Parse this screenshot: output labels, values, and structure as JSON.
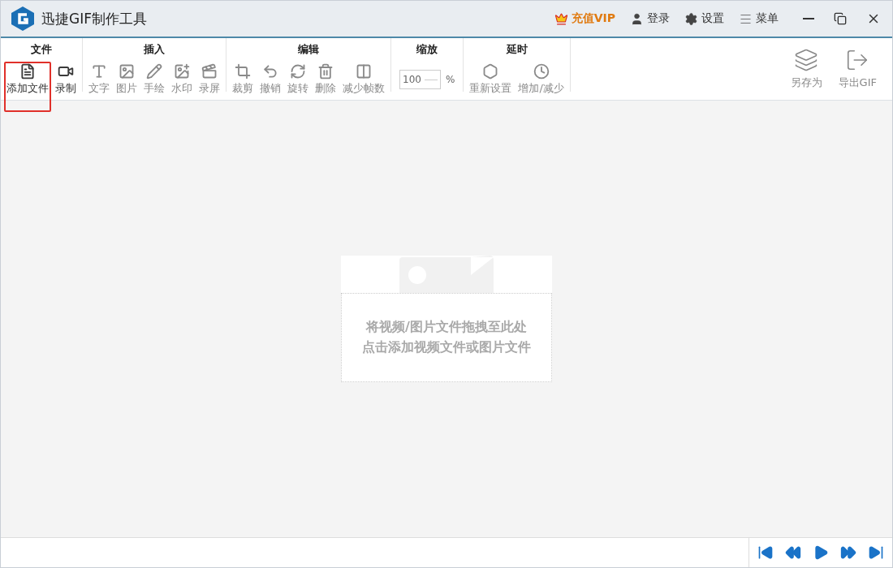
{
  "window": {
    "title": "迅捷GIF制作工具"
  },
  "header_actions": [
    {
      "label": "充值VIP",
      "kind": "vip"
    },
    {
      "label": "登录",
      "kind": "plain"
    },
    {
      "label": "设置",
      "kind": "plain"
    },
    {
      "label": "菜单",
      "kind": "plain"
    }
  ],
  "toolbar_groups": [
    {
      "title": "文件",
      "tools": [
        {
          "label": "添加文件",
          "disabled": false,
          "highlighted": true
        },
        {
          "label": "录制",
          "disabled": false,
          "highlighted": false
        }
      ]
    },
    {
      "title": "插入",
      "tools": [
        {
          "label": "文字",
          "disabled": true,
          "highlighted": false
        },
        {
          "label": "图片",
          "disabled": true,
          "highlighted": false
        },
        {
          "label": "手绘",
          "disabled": true,
          "highlighted": false
        },
        {
          "label": "水印",
          "disabled": true,
          "highlighted": false
        },
        {
          "label": "录屏",
          "disabled": true,
          "highlighted": false
        }
      ]
    },
    {
      "title": "编辑",
      "tools": [
        {
          "label": "裁剪",
          "disabled": true,
          "highlighted": false
        },
        {
          "label": "撤销",
          "disabled": true,
          "highlighted": false
        },
        {
          "label": "旋转",
          "disabled": true,
          "highlighted": false
        },
        {
          "label": "删除",
          "disabled": true,
          "highlighted": false
        },
        {
          "label": "减少帧数",
          "disabled": true,
          "highlighted": false
        }
      ]
    },
    {
      "title": "缩放",
      "zoom": {
        "value": "100",
        "unit": "%"
      }
    },
    {
      "title": "延时",
      "tools": [
        {
          "label": "重新设置",
          "disabled": true,
          "highlighted": false
        },
        {
          "label": "增加/减少",
          "disabled": true,
          "highlighted": false
        }
      ]
    }
  ],
  "right_tools": [
    {
      "label": "另存为",
      "disabled": true
    },
    {
      "label": "导出GIF",
      "disabled": true
    }
  ],
  "drop_zone": {
    "lines": [
      "将视频/图片文件拖拽至此处",
      "点击添加视频文件或图片文件"
    ]
  },
  "playback": [
    {
      "disabled": false
    },
    {
      "disabled": false
    },
    {
      "disabled": false
    },
    {
      "disabled": false
    },
    {
      "disabled": false
    }
  ]
}
